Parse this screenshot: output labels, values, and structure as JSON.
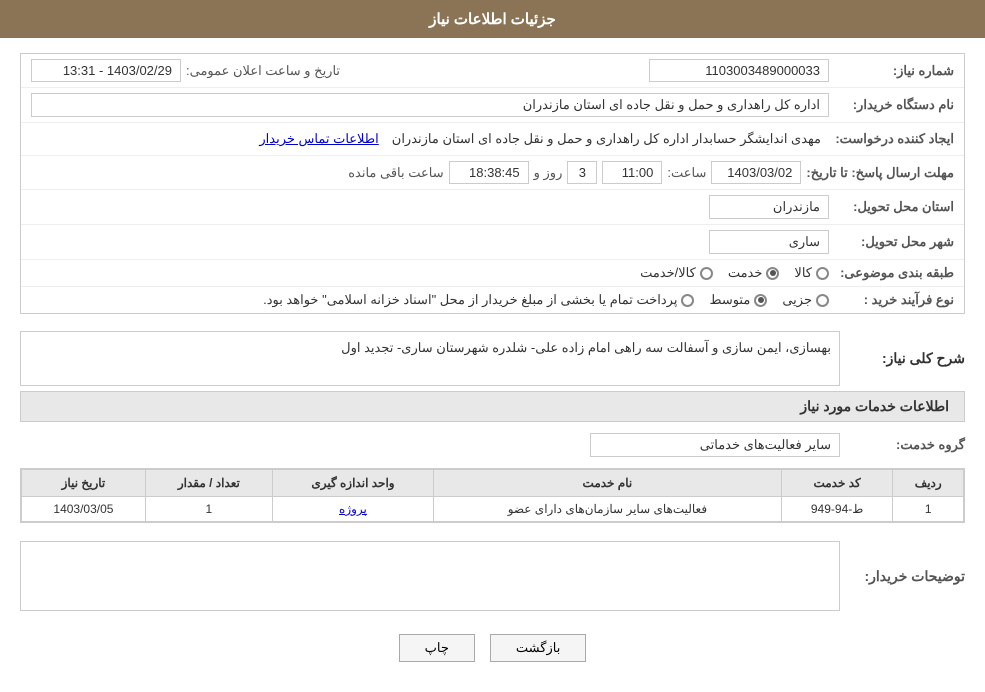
{
  "header": {
    "title": "جزئیات اطلاعات نیاز"
  },
  "fields": {
    "need_number_label": "شماره نیاز:",
    "need_number_value": "1103003489000033",
    "announcement_date_label": "تاریخ و ساعت اعلان عمومی:",
    "announcement_date_value": "1403/02/29 - 13:31",
    "buyer_org_label": "نام دستگاه خریدار:",
    "buyer_org_value": "اداره کل راهداری و حمل و نقل جاده ای استان مازندران",
    "creator_label": "ایجاد کننده درخواست:",
    "creator_value": "مهدی اندایشگر حسابدار اداره کل راهداری و حمل و نقل جاده ای استان مازندران",
    "creator_link": "اطلاعات تماس خریدار",
    "deadline_label": "مهلت ارسال پاسخ: تا تاریخ:",
    "deadline_date": "1403/03/02",
    "deadline_time_label": "ساعت:",
    "deadline_time": "11:00",
    "deadline_days_label": "روز و",
    "deadline_days": "3",
    "deadline_remaining_label": "ساعت باقی مانده",
    "deadline_remaining": "18:38:45",
    "province_label": "استان محل تحویل:",
    "province_value": "مازندران",
    "city_label": "شهر محل تحویل:",
    "city_value": "ساری",
    "category_label": "طبقه بندی موضوعی:",
    "category_options": [
      {
        "label": "کالا",
        "selected": false
      },
      {
        "label": "خدمت",
        "selected": true
      },
      {
        "label": "کالا/خدمت",
        "selected": false
      }
    ],
    "purchase_type_label": "نوع فرآیند خرید :",
    "purchase_type_options": [
      {
        "label": "جزیی",
        "selected": false
      },
      {
        "label": "متوسط",
        "selected": true
      },
      {
        "label": "پرداخت تمام یا بخشی از مبلغ خریدار از محل \"اسناد خزانه اسلامی\" خواهد بود.",
        "selected": false
      }
    ],
    "description_section_title": "شرح کلی نیاز:",
    "description_value": "بهسازی، ایمن سازی و آسفالت سه راهی امام زاده علی- شلدره شهرستان ساری- تجدید اول",
    "services_section_title": "اطلاعات خدمات مورد نیاز",
    "service_group_label": "گروه خدمت:",
    "service_group_value": "سایر فعالیت‌های خدماتی",
    "table": {
      "headers": [
        "ردیف",
        "کد خدمت",
        "نام خدمت",
        "واحد اندازه گیری",
        "تعداد / مقدار",
        "تاریخ نیاز"
      ],
      "rows": [
        {
          "row_num": "1",
          "service_code": "ط-94-949",
          "service_name": "فعالیت‌های سایر سازمان‌های دارای عضو",
          "unit": "پروژه",
          "quantity": "1",
          "date": "1403/03/05"
        }
      ]
    },
    "buyer_notes_label": "توضیحات خریدار:",
    "buyer_notes_value": ""
  },
  "buttons": {
    "print_label": "چاپ",
    "back_label": "بازگشت"
  }
}
